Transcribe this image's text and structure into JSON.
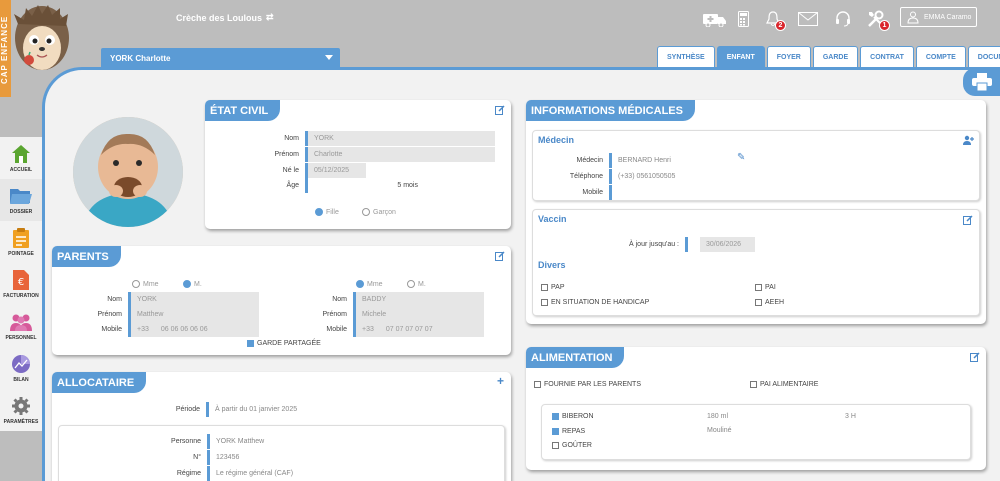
{
  "brand": {
    "side_text": "CAP ENFANCE"
  },
  "header": {
    "creche_name": "Crèche des Loulous",
    "user_name": "EMMA Caramo",
    "notifications_count": "2",
    "settings_badge": "1"
  },
  "child_selector": {
    "name": "YORK Charlotte"
  },
  "tabs": [
    "SYNTHÈSE",
    "ENFANT",
    "FOYER",
    "GARDE",
    "CONTRAT",
    "COMPTE",
    "DOCUMENTS"
  ],
  "nav": [
    {
      "label": "ACCUEIL"
    },
    {
      "label": "DOSSIER"
    },
    {
      "label": "POINTAGE"
    },
    {
      "label": "FACTURATION"
    },
    {
      "label": "PERSONNEL"
    },
    {
      "label": "BILAN"
    },
    {
      "label": "PARAMÈTRES"
    }
  ],
  "etat_civil": {
    "title": "ÉTAT CIVIL",
    "nom_label": "Nom",
    "nom": "YORK",
    "prenom_label": "Prénom",
    "prenom": "Charlotte",
    "ne_label": "Né le",
    "ne": "05/12/2025",
    "age_label": "Âge",
    "age": "5 mois",
    "fille": "Fille",
    "garcon": "Garçon"
  },
  "parents": {
    "title": "PARENTS",
    "mme": "Mme",
    "m": "M.",
    "nom_label": "Nom",
    "prenom_label": "Prénom",
    "mobile_label": "Mobile",
    "p1": {
      "nom": "YORK",
      "prenom": "Matthew",
      "cc": "+33",
      "mobile": "06 06 06 06 06"
    },
    "p2": {
      "nom": "BADDY",
      "prenom": "Michele",
      "cc": "+33",
      "mobile": "07 07 07 07 07"
    },
    "garde": "GARDE PARTAGÉE"
  },
  "allocataire": {
    "title": "ALLOCATAIRE",
    "periode_label": "Période",
    "periode": "À partir du 01 janvier 2025",
    "personne_label": "Personne",
    "personne": "YORK Matthew",
    "num_label": "N°",
    "num": "123456",
    "regime_label": "Régime",
    "regime": "Le régime général (CAF)"
  },
  "medical": {
    "title": "INFORMATIONS MÉDICALES",
    "medecin_title": "Médecin",
    "medecin_label": "Médecin",
    "medecin": "BERNARD Henri",
    "tel_label": "Téléphone",
    "tel": "(+33) 0561050505",
    "mobile_label": "Mobile",
    "vaccin_title": "Vaccin",
    "ajour_label": "À jour jusqu'au :",
    "ajour": "30/06/2026",
    "divers_title": "Divers",
    "pap": "PAP",
    "pai": "PAI",
    "handicap": "EN SITUATION DE HANDICAP",
    "aeeh": "AEEH"
  },
  "alimentation": {
    "title": "ALIMENTATION",
    "fournie": "FOURNIE PAR LES PARENTS",
    "pai": "PAI ALIMENTAIRE",
    "biberon": "BIBERON",
    "biberon_qty": "180 ml",
    "biberon_freq": "3 H",
    "repas": "REPAS",
    "repas_type": "Mouliné",
    "gouter": "GOÛTER"
  },
  "colors": {
    "accent": "#5b9bd5",
    "header": "#bdbdbd",
    "badge": "#d9262d",
    "brand": "#e89a3c"
  }
}
